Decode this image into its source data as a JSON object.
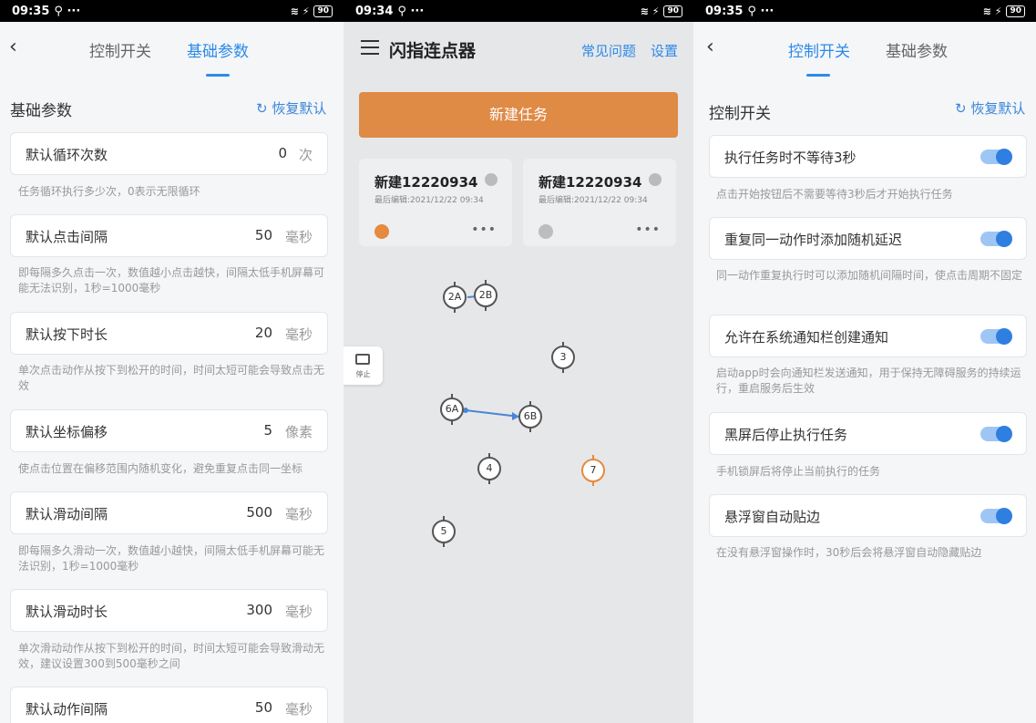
{
  "left_phone": {
    "status": {
      "time": "09:35",
      "battery": "90"
    },
    "tabs": [
      "控制开关",
      "基础参数"
    ],
    "section_title": "基础参数",
    "reset_label": "恢复默认",
    "params": [
      {
        "label": "默认循环次数",
        "value": "0",
        "unit": "次",
        "hint": "任务循环执行多少次，0表示无限循环"
      },
      {
        "label": "默认点击间隔",
        "value": "50",
        "unit": "毫秒",
        "hint": "即每隔多久点击一次，数值越小点击越快，间隔太低手机屏幕可能无法识别，1秒=1000毫秒"
      },
      {
        "label": "默认按下时长",
        "value": "20",
        "unit": "毫秒",
        "hint": "单次点击动作从按下到松开的时间，时间太短可能会导致点击无效"
      },
      {
        "label": "默认坐标偏移",
        "value": "5",
        "unit": "像素",
        "hint": "使点击位置在偏移范围内随机变化，避免重复点击同一坐标"
      },
      {
        "label": "默认滑动间隔",
        "value": "500",
        "unit": "毫秒",
        "hint": "即每隔多久滑动一次，数值越小越快，间隔太低手机屏幕可能无法识别，1秒=1000毫秒"
      },
      {
        "label": "默认滑动时长",
        "value": "300",
        "unit": "毫秒",
        "hint": "单次滑动动作从按下到松开的时间，时间太短可能会导致滑动无效，建议设置300到500毫秒之间"
      },
      {
        "label": "默认动作间隔",
        "value": "50",
        "unit": "毫秒"
      }
    ]
  },
  "middle_phone": {
    "status": {
      "time": "09:34",
      "battery": "90"
    },
    "app_title": "闪指连点器",
    "faq_label": "常见问题",
    "settings_label": "设置",
    "new_task_label": "新建任务",
    "tasks": [
      {
        "name": "新建12220934",
        "edited": "最后编辑:2021/12/22 09:34",
        "more": "•••"
      },
      {
        "name": "新建12220934",
        "edited": "最后编辑:2021/12/22 09:34",
        "more": "•••"
      }
    ],
    "stop_label": "停止",
    "points": [
      "2A",
      "2B",
      "3",
      "6A",
      "6B",
      "4",
      "7",
      "5"
    ]
  },
  "right_phone": {
    "status": {
      "time": "09:35",
      "battery": "90"
    },
    "tabs": [
      "控制开关",
      "基础参数"
    ],
    "section_title": "控制开关",
    "reset_label": "恢复默认",
    "switches": [
      {
        "label": "执行任务时不等待3秒",
        "hint": "点击开始按钮后不需要等待3秒后才开始执行任务",
        "on": true
      },
      {
        "label": "重复同一动作时添加随机延迟",
        "hint": "同一动作重复执行时可以添加随机间隔时间，使点击周期不固定",
        "on": true
      },
      {
        "label": "允许在系统通知栏创建通知",
        "hint": "启动app时会向通知栏发送通知，用于保持无障碍服务的持续运行，重启服务后生效",
        "on": true
      },
      {
        "label": "黑屏后停止执行任务",
        "hint": "手机锁屏后将停止当前执行的任务",
        "on": true
      },
      {
        "label": "悬浮窗自动贴边",
        "hint": "在没有悬浮窗操作时，30秒后会将悬浮窗自动隐藏贴边",
        "on": true
      }
    ]
  },
  "colors": {
    "accent_blue": "#2c8ae8",
    "orange": "#df8a45"
  }
}
